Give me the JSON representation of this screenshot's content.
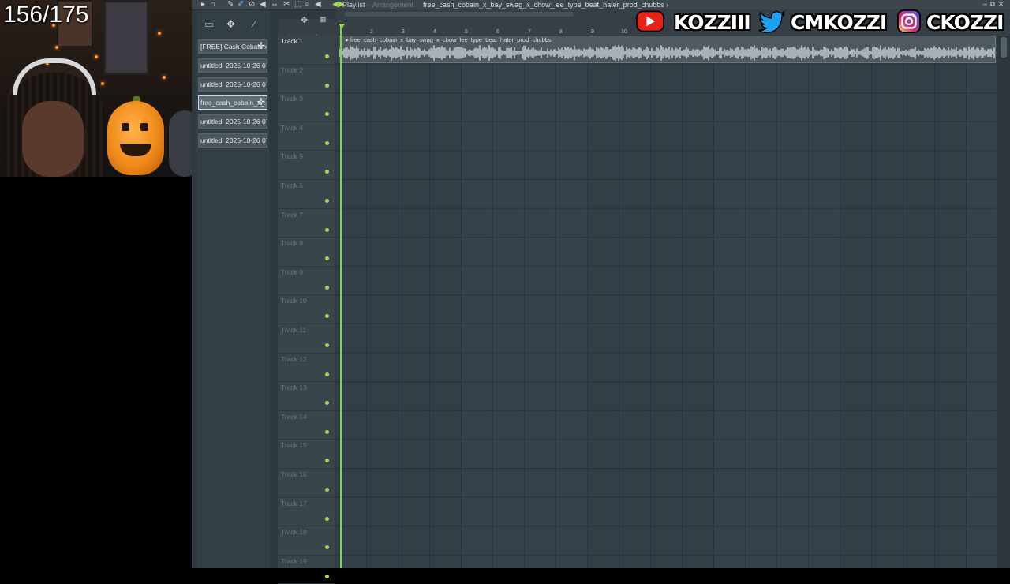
{
  "overlay": {
    "counter": "156/175",
    "socials": [
      {
        "icon": "youtube-icon",
        "handle": "KOZZIII",
        "color": "#e62117"
      },
      {
        "icon": "twitter-icon",
        "handle": "CMKOZZI",
        "color": "#1da1f2"
      },
      {
        "icon": "instagram-icon",
        "handle": "CKOZZI",
        "color": "#c13584"
      }
    ]
  },
  "daw": {
    "window": {
      "title": "Playlist",
      "separator": "-",
      "subtitle": "Arrangement",
      "pattern": "free_cash_cobain_x_bay_swag_x_chow_lee_type_beat_hater_prod_chubbs",
      "pattern_arrow": "›"
    },
    "picker": {
      "items": [
        {
          "label": "[FREE] Cash Cobain x...",
          "has_plus": true,
          "selected": false
        },
        {
          "label": "untitled_2025-10-26 07-...",
          "has_plus": false,
          "selected": false
        },
        {
          "label": "untitled_2025-10-26 07-...",
          "has_plus": false,
          "selected": false
        },
        {
          "label": "free_cash_cobain_x_...",
          "has_plus": true,
          "selected": true
        },
        {
          "label": "untitled_2025-10-26 07-...",
          "has_plus": false,
          "selected": false
        },
        {
          "label": "untitled_2025-10-26 07-...",
          "has_plus": false,
          "selected": false
        }
      ]
    },
    "timeline": {
      "bars": [
        "2",
        "3",
        "4",
        "5",
        "6",
        "7",
        "8",
        "9",
        "10"
      ]
    },
    "clip": {
      "name": "free_cash_cobain_x_bay_swag_x_chow_lee_type_beat_hater_prod_chubbs"
    },
    "tracks": [
      "Track 1",
      "Track 2",
      "Track 3",
      "Track 4",
      "Track 5",
      "Track 6",
      "Track 7",
      "Track 8",
      "Track 9",
      "Track 10",
      "Track 11",
      "Track 12",
      "Track 13",
      "Track 14",
      "Track 15",
      "Track 16",
      "Track 17",
      "Track 18",
      "Track 19"
    ]
  }
}
